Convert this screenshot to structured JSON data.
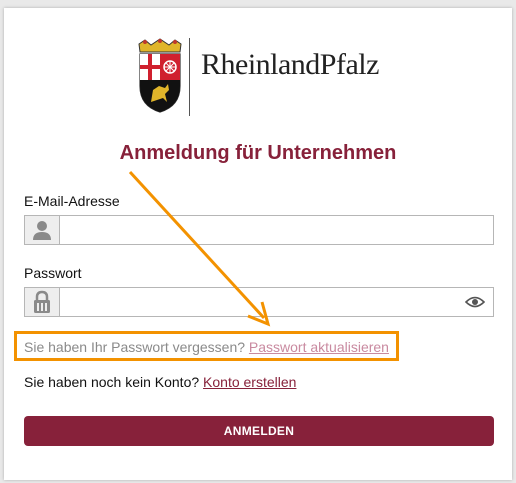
{
  "brand": {
    "name": "RheinlandPfalz"
  },
  "page": {
    "title": "Anmeldung für Unternehmen"
  },
  "form": {
    "email": {
      "label": "E-Mail-Adresse",
      "value": "",
      "placeholder": ""
    },
    "password": {
      "label": "Passwort",
      "value": "",
      "placeholder": ""
    },
    "forgot": {
      "text": "Sie haben Ihr Passwort vergessen?",
      "link": "Passwort aktualisieren"
    },
    "register": {
      "text": "Sie haben noch kein Konto?",
      "link": "Konto erstellen"
    },
    "submit_label": "ANMELDEN"
  },
  "icons": {
    "email": "user-icon",
    "password": "lock-icon",
    "toggle": "eye-icon",
    "crest": "coat-of-arms-icon"
  },
  "colors": {
    "brand": "#87213a",
    "highlight": "#f39200"
  }
}
